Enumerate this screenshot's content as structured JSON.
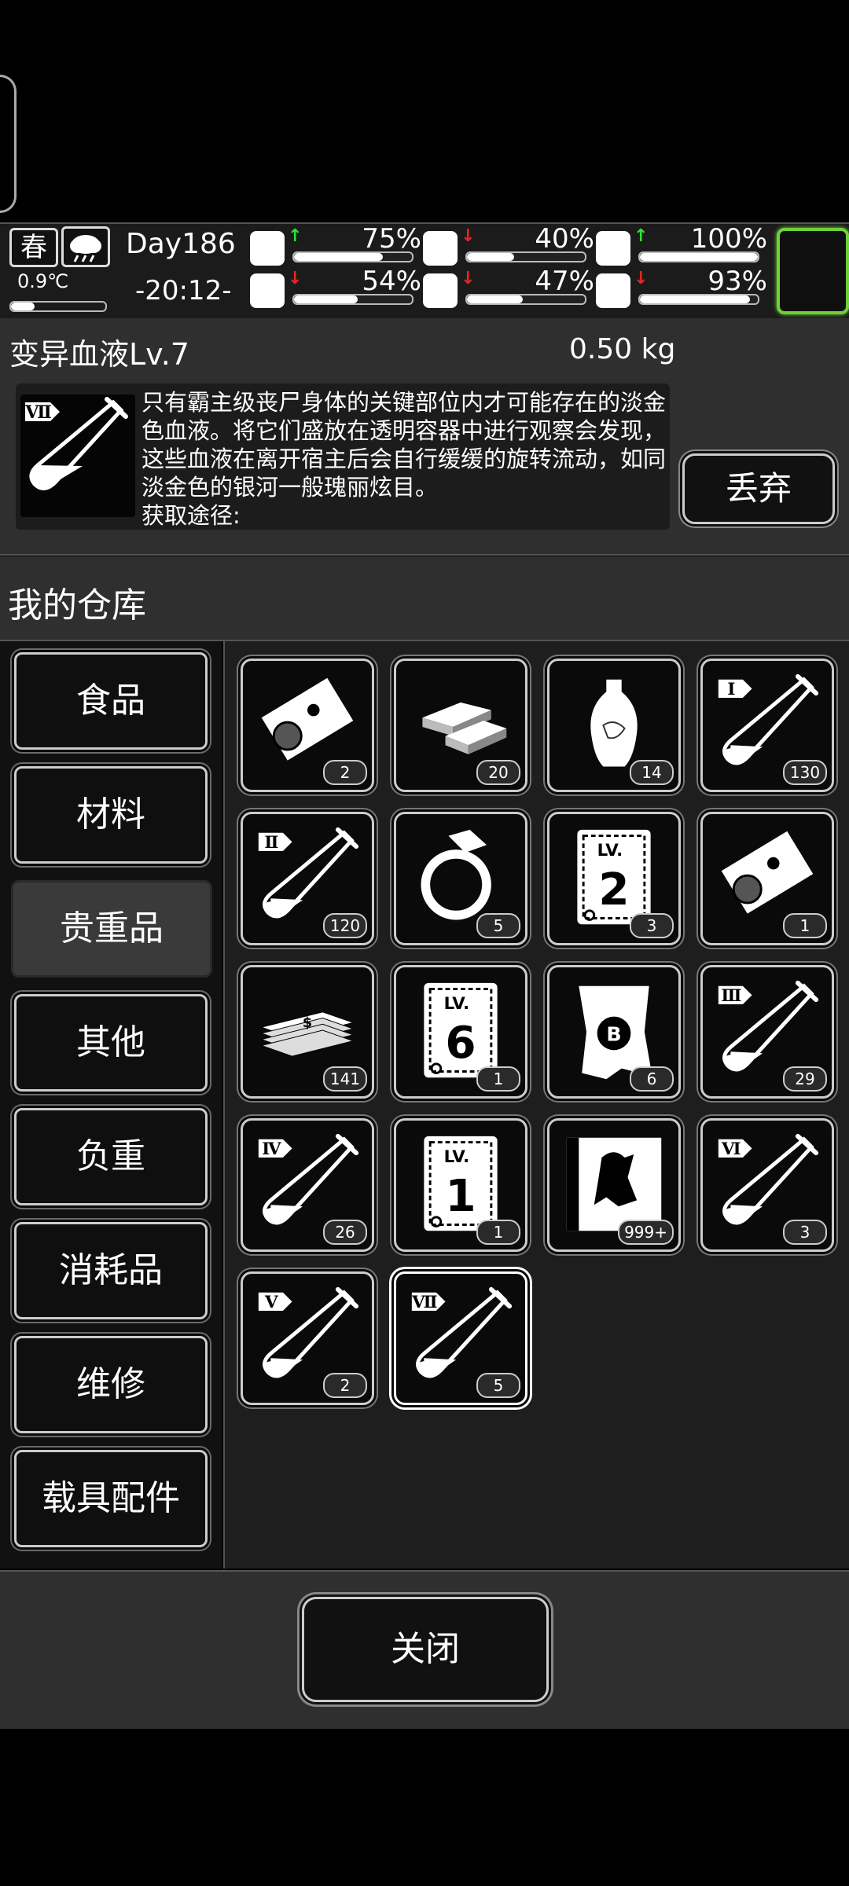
{
  "status": {
    "season": "春",
    "temperature": "0.9℃",
    "temperature_level": 0.25,
    "day": "Day186",
    "time": "-20:12-",
    "stats": [
      {
        "name": "health",
        "icon": "medkit-icon",
        "value": "75%",
        "fill": 0.75,
        "trend": "up"
      },
      {
        "name": "hunger",
        "icon": "stomach-icon",
        "value": "40%",
        "fill": 0.4,
        "trend": "down"
      },
      {
        "name": "mood",
        "icon": "capsule-icon",
        "value": "100%",
        "fill": 1.0,
        "trend": "up"
      },
      {
        "name": "stamina",
        "icon": "boot-icon",
        "value": "54%",
        "fill": 0.54,
        "trend": "down"
      },
      {
        "name": "thirst",
        "icon": "water-drop-icon",
        "value": "47%",
        "fill": 0.47,
        "trend": "down"
      },
      {
        "name": "spirit",
        "icon": "heart-icon",
        "value": "93%",
        "fill": 0.93,
        "trend": "down"
      }
    ]
  },
  "item": {
    "name": "变异血液Lv.7",
    "weight": "0.50 kg",
    "icon": "test-tube-vii-icon",
    "numeral": "Ⅶ",
    "description": "只有霸主级丧尸身体的关键部位内才可能存在的淡金色血液。将它们盛放在透明容器中进行观察会发现，这些血液在离开宿主后会自行缓缓的旋转流动，如同淡金色的银河一般瑰丽炫目。",
    "source_label": "获取途径:",
    "discard_label": "丢弃"
  },
  "warehouse": {
    "title": "我的仓库",
    "categories": [
      "食品",
      "材料",
      "贵重品",
      "其他",
      "负重",
      "消耗品",
      "维修",
      "载具配件"
    ],
    "active_category": "贵重品",
    "items": [
      {
        "icon": "ticket-portrait-icon",
        "count": "2"
      },
      {
        "icon": "gold-bars-icon",
        "count": "20"
      },
      {
        "icon": "vase-icon",
        "count": "14"
      },
      {
        "icon": "test-tube-i-icon",
        "count": "130",
        "numeral": "Ⅰ"
      },
      {
        "icon": "test-tube-ii-icon",
        "count": "120",
        "numeral": "Ⅱ"
      },
      {
        "icon": "diamond-ring-icon",
        "count": "5"
      },
      {
        "icon": "card-lv2-icon",
        "count": "3",
        "level": "2"
      },
      {
        "icon": "ticket-portrait-icon",
        "count": "1"
      },
      {
        "icon": "cash-stack-icon",
        "count": "141"
      },
      {
        "icon": "card-lv6-icon",
        "count": "1",
        "level": "6"
      },
      {
        "icon": "bitcoin-paper-icon",
        "count": "6"
      },
      {
        "icon": "test-tube-iii-icon",
        "count": "29",
        "numeral": "Ⅲ"
      },
      {
        "icon": "test-tube-iv-icon",
        "count": "26",
        "numeral": "Ⅳ"
      },
      {
        "icon": "card-lv1-icon",
        "count": "1",
        "level": "1"
      },
      {
        "icon": "zombie-card-icon",
        "count": "999+"
      },
      {
        "icon": "test-tube-vi-icon",
        "count": "3",
        "numeral": "Ⅵ"
      },
      {
        "icon": "test-tube-v-icon",
        "count": "2",
        "numeral": "Ⅴ"
      },
      {
        "icon": "test-tube-vii-icon",
        "count": "5",
        "numeral": "Ⅶ",
        "selected": true
      }
    ]
  },
  "close_label": "关闭",
  "colors": {
    "accent_green": "#6fd13a",
    "trend_up": "#2ee52e",
    "trend_down": "#e62626",
    "panel": "#2f2f2f"
  }
}
